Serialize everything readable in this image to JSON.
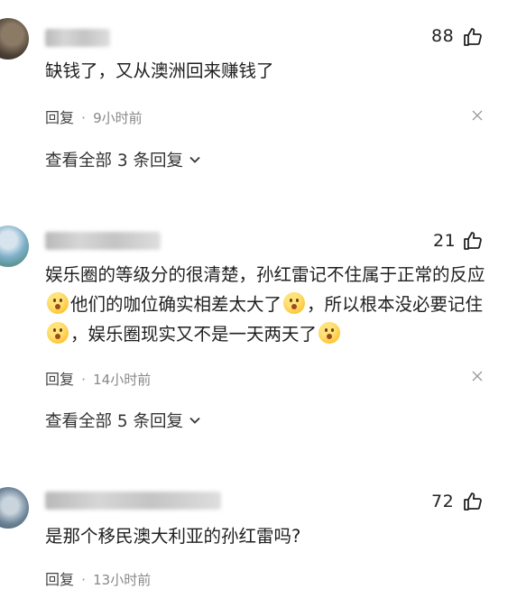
{
  "comments": [
    {
      "likes": "88",
      "text": "缺钱了，又从澳洲回来赚钱了",
      "reply_label": "回复",
      "separator": "·",
      "time": "9小时前",
      "view_replies": "查看全部 3 条回复"
    },
    {
      "likes": "21",
      "text_parts": [
        "娱乐圈的等级分的很清楚，孙红雷记不住属于正常的反应",
        "他们的咖位确实相差太大了",
        "，所以根本没必要记住",
        "，娱乐圈现实又不是一天两天了"
      ],
      "reply_label": "回复",
      "separator": "·",
      "time": "14小时前",
      "view_replies": "查看全部 5 条回复"
    },
    {
      "likes": "72",
      "text": "是那个移民澳大利亚的孙红雷吗?",
      "reply_label": "回复",
      "separator": "·",
      "time": "13小时前"
    }
  ],
  "icons": {
    "like": "thumbs-up-icon",
    "dismiss": "close-icon",
    "expand": "chevron-down-icon",
    "emoji": "shy-face-emoji-icon"
  }
}
